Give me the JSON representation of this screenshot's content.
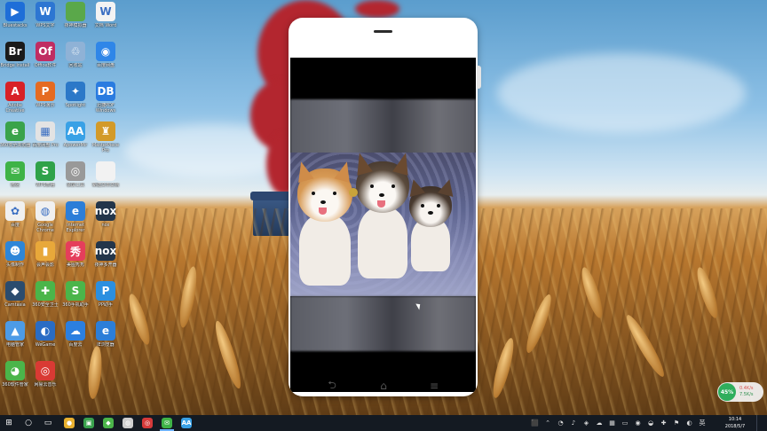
{
  "desktop": {
    "icons": [
      {
        "label": "Bluestacks",
        "glyph": "▶",
        "color": "#1e6ed8"
      },
      {
        "label": "WPS文字",
        "glyph": "W",
        "color": "#2d76d2"
      },
      {
        "label": "夜神模拟器",
        "glyph": "",
        "color": "#5aa84a"
      },
      {
        "label": "文档 Word",
        "glyph": "W",
        "color": "#f3f3f3"
      },
      {
        "label": "Bridge Install",
        "glyph": "Br",
        "color": "#1b1b1b"
      },
      {
        "label": "Office软件",
        "glyph": "Of",
        "color": "#c02d62"
      },
      {
        "label": "回收站",
        "glyph": "♲",
        "color": "#8fb2d6"
      },
      {
        "label": "百度网盘",
        "glyph": "◉",
        "color": "#2f86e8"
      },
      {
        "label": "Adobe Creative",
        "glyph": "A",
        "color": "#d82127"
      },
      {
        "label": "WPS演示",
        "glyph": "P",
        "color": "#e56b22"
      },
      {
        "label": "Spotlight",
        "glyph": "✦",
        "color": "#2c78c8"
      },
      {
        "label": "迅捷PDF Windows",
        "glyph": "DB",
        "color": "#2a7be0"
      },
      {
        "label": "360安全浏览器",
        "glyph": "e",
        "color": "#3aa34b"
      },
      {
        "label": "百度网盘 Pro",
        "glyph": "▦",
        "color": "#e3e3e3"
      },
      {
        "label": "ApowerMir",
        "glyph": "AA",
        "color": "#39a1e6"
      },
      {
        "label": "MasterPiece Pro",
        "glyph": "♜",
        "color": "#d39a29"
      },
      {
        "label": "微信",
        "glyph": "✉",
        "color": "#3fb347"
      },
      {
        "label": "WPS表格",
        "glyph": "S",
        "color": "#2fa249"
      },
      {
        "label": "录屏工具",
        "glyph": "◎",
        "color": "#999999"
      },
      {
        "label": "新建文本文档",
        "glyph": "",
        "color": "#f2f2f2"
      },
      {
        "label": "百度",
        "glyph": "✿",
        "color": "#f0f0f0"
      },
      {
        "label": "Google Chrome",
        "glyph": "◍",
        "color": "#f0f0f0"
      },
      {
        "label": "Internet Explorer",
        "glyph": "e",
        "color": "#2c7ed8"
      },
      {
        "label": "nox",
        "glyph": "nox",
        "color": "#23354a"
      },
      {
        "label": "头像制作",
        "glyph": "☻",
        "color": "#2e86d8"
      },
      {
        "label": "会声会影",
        "glyph": "▮",
        "color": "#e8a83a"
      },
      {
        "label": "美图秀秀",
        "glyph": "秀",
        "color": "#e53e5b"
      },
      {
        "label": "夜神多开器",
        "glyph": "nox",
        "color": "#23354a"
      },
      {
        "label": "Camtasia",
        "glyph": "◆",
        "color": "#2b4c6e"
      },
      {
        "label": "360安全卫士",
        "glyph": "✚",
        "color": "#4bb54a"
      },
      {
        "label": "360手机助手",
        "glyph": "S",
        "color": "#4bb54a"
      },
      {
        "label": "PP助手",
        "glyph": "P",
        "color": "#2b8fe0"
      },
      {
        "label": "电脑管家",
        "glyph": "▲",
        "color": "#4d9be6"
      },
      {
        "label": "WeGame",
        "glyph": "◐",
        "color": "#2a6cc4"
      },
      {
        "label": "百度云",
        "glyph": "☁",
        "color": "#2b7fe0"
      },
      {
        "label": "IE浏览器",
        "glyph": "e",
        "color": "#2c7ed8"
      },
      {
        "label": "360软件管家",
        "glyph": "◕",
        "color": "#4bb54a"
      },
      {
        "label": "网易云音乐",
        "glyph": "◎",
        "color": "#d93a34"
      }
    ]
  },
  "phone": {
    "nav": {
      "back": "⮌",
      "home": "⌂",
      "menu": "≡"
    }
  },
  "network": {
    "percent": "45%",
    "up": "0.4K/s",
    "down": "7.5K/s"
  },
  "taskbar": {
    "start": "⊞",
    "search": "○",
    "taskview": "▭",
    "apps": [
      {
        "glyph": "●",
        "color": "#e8b030"
      },
      {
        "glyph": "▣",
        "color": "#3aa24e"
      },
      {
        "glyph": "◆",
        "color": "#4bb54a"
      },
      {
        "glyph": "◍",
        "color": "#cfcfcf"
      },
      {
        "glyph": "◎",
        "color": "#d63a3a"
      },
      {
        "glyph": "✉",
        "color": "#3fb347"
      },
      {
        "glyph": "AA",
        "color": "#39a1e6"
      }
    ],
    "tray": [
      "⬛",
      "⌃",
      "◔",
      "♪",
      "◈",
      "☁",
      "▦",
      "▭",
      "◉",
      "◒",
      "✚",
      "⚑",
      "◐",
      "英"
    ],
    "time": "10:14",
    "date": "2018/5/7"
  }
}
